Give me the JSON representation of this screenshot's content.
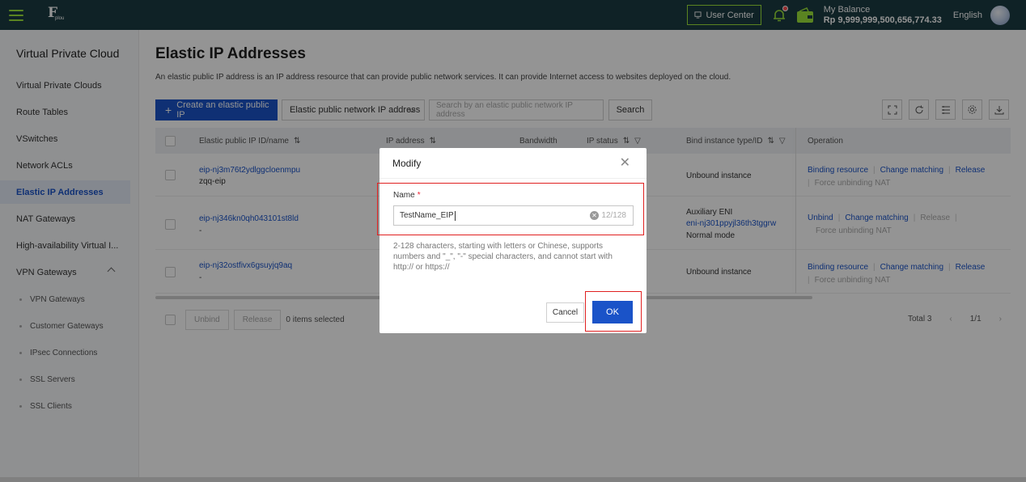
{
  "topbar": {
    "logo_text": "F",
    "logo_sub": "plou",
    "user_center": "User Center",
    "balance_label": "My Balance",
    "balance_value": "Rp 9,999,999,500,656,774.33",
    "language": "English"
  },
  "sidebar": {
    "title": "Virtual Private Cloud",
    "items": [
      {
        "label": "Virtual Private Clouds"
      },
      {
        "label": "Route Tables"
      },
      {
        "label": "VSwitches"
      },
      {
        "label": "Network ACLs"
      },
      {
        "label": "Elastic IP Addresses",
        "active": true
      },
      {
        "label": "NAT Gateways"
      },
      {
        "label": "High-availability Virtual I..."
      },
      {
        "label": "VPN Gateways"
      }
    ],
    "sub_items": [
      {
        "label": "VPN Gateways"
      },
      {
        "label": "Customer Gateways"
      },
      {
        "label": "IPsec Connections"
      },
      {
        "label": "SSL Servers"
      },
      {
        "label": "SSL Clients"
      }
    ]
  },
  "main": {
    "title": "Elastic IP Addresses",
    "description": "An elastic public IP address is an IP address resource that can provide public network services. It can provide Internet access to websites deployed on the cloud.",
    "create_button": "Create an elastic public IP",
    "filter_select": "Elastic public network IP address",
    "search_placeholder": "Search by an elastic public network IP address",
    "search_button": "Search"
  },
  "table": {
    "columns": {
      "id_name": "Elastic public IP ID/name",
      "ip_address": "IP address",
      "bandwidth": "Bandwidth",
      "ip_status": "IP status",
      "bind_instance": "Bind instance type/ID",
      "operation": "Operation"
    },
    "rows": [
      {
        "id": "eip-nj3m76t2ydlggcloenmpu",
        "name": "zqq-eip",
        "bind_line1": "Unbound instance",
        "bind_line2": "",
        "bind_line3": "",
        "ops": [
          "Binding resource",
          "Change matching",
          "Release"
        ],
        "ops2": "Force unbinding NAT"
      },
      {
        "id": "eip-nj346kn0qh043101st8ld",
        "name": "-",
        "bind_line1": "Auxiliary ENI",
        "bind_line2": "eni-nj301ppyjl36th3tggrw",
        "bind_line3": "Normal mode",
        "ops": [
          "Unbind",
          "Change matching",
          "Release"
        ],
        "ops2": "Force unbinding NAT"
      },
      {
        "id": "eip-nj32ostfivx6gsuyjq9aq",
        "name": "-",
        "bind_line1": "Unbound instance",
        "bind_line2": "",
        "bind_line3": "",
        "ops": [
          "Binding resource",
          "Change matching",
          "Release"
        ],
        "ops2": "Force unbinding NAT"
      }
    ],
    "footer": {
      "unbind": "Unbind",
      "release": "Release",
      "selected": "0 items selected",
      "total": "Total 3",
      "page": "1/1"
    }
  },
  "modal": {
    "title": "Modify",
    "field_label": "Name",
    "required_mark": "*",
    "field_value": "TestName_EIP",
    "char_count": "12/128",
    "hint": "2-128 characters, starting with letters or Chinese, supports numbers and \"_\", \"-\" special characters, and cannot start with http:// or https://",
    "cancel": "Cancel",
    "ok": "OK"
  },
  "colors": {
    "topbar": "#1b3b42",
    "accent": "#9be33a",
    "primary": "#1a53c8",
    "highlight": "#e02020"
  }
}
